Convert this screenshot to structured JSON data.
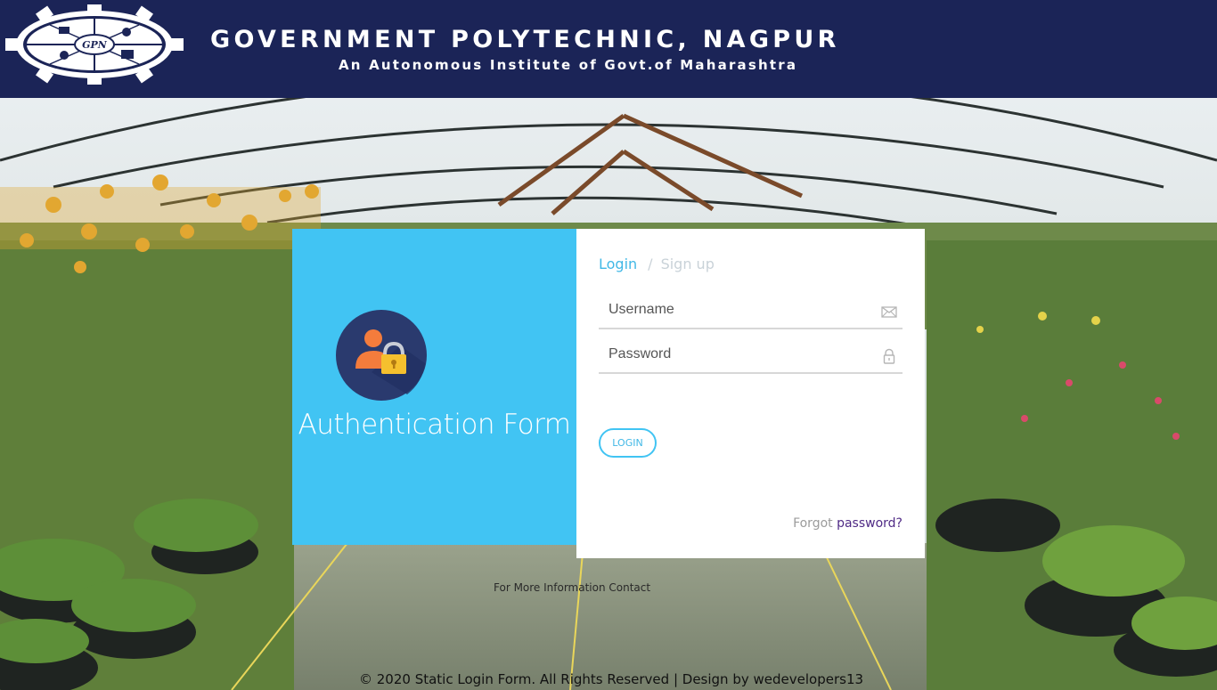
{
  "header": {
    "institute_name": "GOVERNMENT POLYTECHNIC, NAGPUR",
    "institute_sub": "An Autonomous Institute of Govt.of Maharashtra",
    "logo_text": "GPN",
    "background": "#1b2457"
  },
  "auth_panel": {
    "title": "Authentication Form",
    "accent": "#41c4f3",
    "icon": "user-lock-icon"
  },
  "login_form": {
    "tabs": [
      {
        "label": "Login",
        "active": true
      },
      {
        "label": "Sign up",
        "active": false
      }
    ],
    "separator": "/",
    "username": {
      "placeholder": "Username",
      "value": "",
      "icon": "envelope-icon"
    },
    "password": {
      "placeholder": "Password",
      "value": "",
      "icon": "lock-icon"
    },
    "login_button": "LOGIN",
    "forgot_prefix": "Forgot",
    "forgot_link": "password?"
  },
  "contact_text": "For More Information Contact",
  "footer": {
    "text": "© 2020 Static Login Form. All Rights Reserved | Design by",
    "link": "wedevelopers13"
  }
}
